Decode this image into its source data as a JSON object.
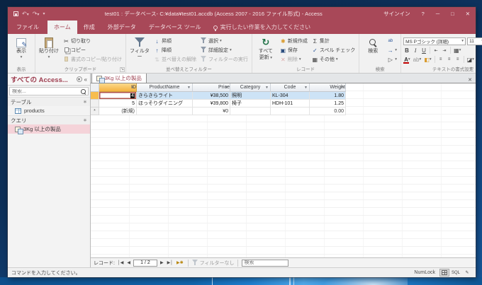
{
  "window": {
    "title": "test01 : データベース- C:¥data¥test01.accdb (Access 2007 - 2016 ファイル形式) - Access",
    "signin": "サインイン",
    "help": "?",
    "minimize": "─",
    "maximize": "□",
    "close": "✕"
  },
  "ribbon": {
    "tabs": [
      {
        "label": "ファイル"
      },
      {
        "label": "ホーム"
      },
      {
        "label": "作成"
      },
      {
        "label": "外部データ"
      },
      {
        "label": "データベース ツール"
      }
    ],
    "tell_me": "実行したい作業を入力してください",
    "view": {
      "label": "表示",
      "button": "表示"
    },
    "clipboard": {
      "label": "クリップボード",
      "paste": "貼り付け",
      "cut": "切り取り",
      "copy": "コピー",
      "format_painter": "書式のコピー/貼り付け"
    },
    "sort": {
      "label": "並べ替えとフィルター",
      "filter": "フィルター",
      "asc": "昇順",
      "desc": "降順",
      "clear": "並べ替えの解除",
      "selection": "選択",
      "advanced": "詳細設定",
      "toggle": "フィルターの実行"
    },
    "records": {
      "label": "レコード",
      "refresh_1": "すべて",
      "refresh_2": "更新",
      "new": "新規作成",
      "save": "保存",
      "delete": "削除",
      "totals": "集計",
      "spell": "スペル チェック",
      "more": "その他"
    },
    "find": {
      "label": "検索",
      "find": "検索",
      "replace": "置換",
      "goto": "ジャンプ",
      "select": "選択"
    },
    "text": {
      "label": "テキストの書式設定",
      "font": "MS Pゴシック (詳細)",
      "size": "11"
    }
  },
  "sidebar": {
    "title": "すべての Access...",
    "search_placeholder": "検索...",
    "table_section": "テーブル",
    "query_section": "クエリ",
    "table_item": "products",
    "query_item": "3Kg 以上の製品"
  },
  "document": {
    "tab": "3Kg 以上の製品",
    "columns": [
      "ID",
      "ProductName",
      "Price",
      "Category",
      "Code",
      "Weight"
    ],
    "rows": [
      {
        "id": "4",
        "name": "きらきらライト",
        "price": "¥38,500",
        "category": "照明",
        "code": "KL-304",
        "weight": "1.80"
      },
      {
        "id": "5",
        "name": "ほっそりダイニング",
        "price": "¥39,800",
        "category": "椅子",
        "code": "HDH-101",
        "weight": "1.25"
      },
      {
        "id": "(新規)",
        "name": "",
        "price": "¥0",
        "category": "",
        "code": "",
        "weight": "0.00"
      }
    ],
    "new_row_marker": "*",
    "nav": {
      "label": "レコード:",
      "position": "1 / 2",
      "filter": "フィルターなし",
      "search_placeholder": "検索"
    }
  },
  "statusbar": {
    "message": "コマンドを入力してください。",
    "numlock": "NumLock",
    "sql": "SQL"
  }
}
